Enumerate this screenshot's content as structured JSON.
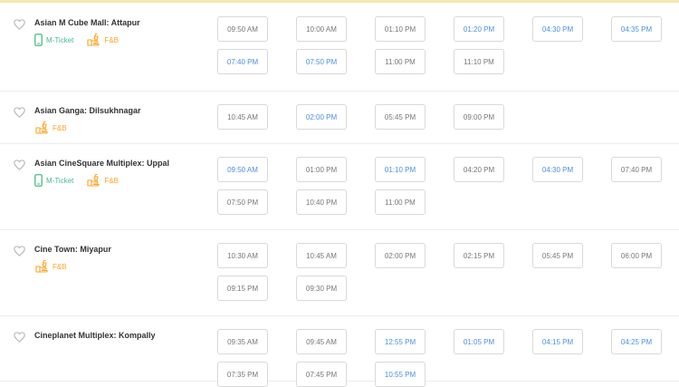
{
  "venues": [
    {
      "name": "Asian M Cube Mall: Attapur",
      "mticket": true,
      "fnb": true,
      "times": [
        {
          "t": "09:50 AM",
          "a": false
        },
        {
          "t": "10:00 AM",
          "a": false
        },
        {
          "t": "01:10 PM",
          "a": false
        },
        {
          "t": "01:20 PM",
          "a": true
        },
        {
          "t": "04:30 PM",
          "a": true
        },
        {
          "t": "04:35 PM",
          "a": true
        },
        {
          "t": "07:40 PM",
          "a": true
        },
        {
          "t": "07:50 PM",
          "a": true
        },
        {
          "t": "11:00 PM",
          "a": false
        },
        {
          "t": "11:10 PM",
          "a": false
        }
      ]
    },
    {
      "name": "Asian Ganga: Dilsukhnagar",
      "mticket": false,
      "fnb": true,
      "times": [
        {
          "t": "10:45 AM",
          "a": false
        },
        {
          "t": "02:00 PM",
          "a": true
        },
        {
          "t": "05:45 PM",
          "a": false
        },
        {
          "t": "09:00 PM",
          "a": false
        }
      ]
    },
    {
      "name": "Asian CineSquare Multiplex: Uppal",
      "mticket": true,
      "fnb": true,
      "times": [
        {
          "t": "09:50 AM",
          "a": true
        },
        {
          "t": "01:00 PM",
          "a": false
        },
        {
          "t": "01:10 PM",
          "a": true
        },
        {
          "t": "04:20 PM",
          "a": false
        },
        {
          "t": "04:30 PM",
          "a": true
        },
        {
          "t": "07:40 PM",
          "a": false
        },
        {
          "t": "07:50 PM",
          "a": false
        },
        {
          "t": "10:40 PM",
          "a": false
        },
        {
          "t": "11:00 PM",
          "a": false
        }
      ]
    },
    {
      "name": "Cine Town: Miyapur",
      "mticket": false,
      "fnb": true,
      "times": [
        {
          "t": "10:30 AM",
          "a": false
        },
        {
          "t": "10:45 AM",
          "a": false
        },
        {
          "t": "02:00 PM",
          "a": false
        },
        {
          "t": "02:15 PM",
          "a": false
        },
        {
          "t": "05:45 PM",
          "a": false
        },
        {
          "t": "06:00 PM",
          "a": false
        },
        {
          "t": "09:15 PM",
          "a": false
        },
        {
          "t": "09:30 PM",
          "a": false
        }
      ]
    },
    {
      "name": "Cineplanet Multiplex: Kompally",
      "mticket": false,
      "fnb": false,
      "times": [
        {
          "t": "09:35 AM",
          "a": false
        },
        {
          "t": "09:45 AM",
          "a": false
        },
        {
          "t": "12:55 PM",
          "a": true
        },
        {
          "t": "01:05 PM",
          "a": true
        },
        {
          "t": "04:15 PM",
          "a": true
        },
        {
          "t": "04:25 PM",
          "a": true
        },
        {
          "t": "07:35 PM",
          "a": false
        },
        {
          "t": "07:45 PM",
          "a": false
        },
        {
          "t": "10:55 PM",
          "a": true
        }
      ]
    }
  ],
  "labels": {
    "mticket": "M-Ticket",
    "fnb": "F&B"
  },
  "colors": {
    "available": "#4a90e2",
    "unavailable": "#777777",
    "mticket": "#49ba8e",
    "fnb": "#ffa426",
    "heart": "#b5b5b5"
  },
  "icons": {
    "favorite": "heart-icon",
    "mticket": "mobile-phone-icon",
    "fnb": "food-beverage-icon"
  }
}
